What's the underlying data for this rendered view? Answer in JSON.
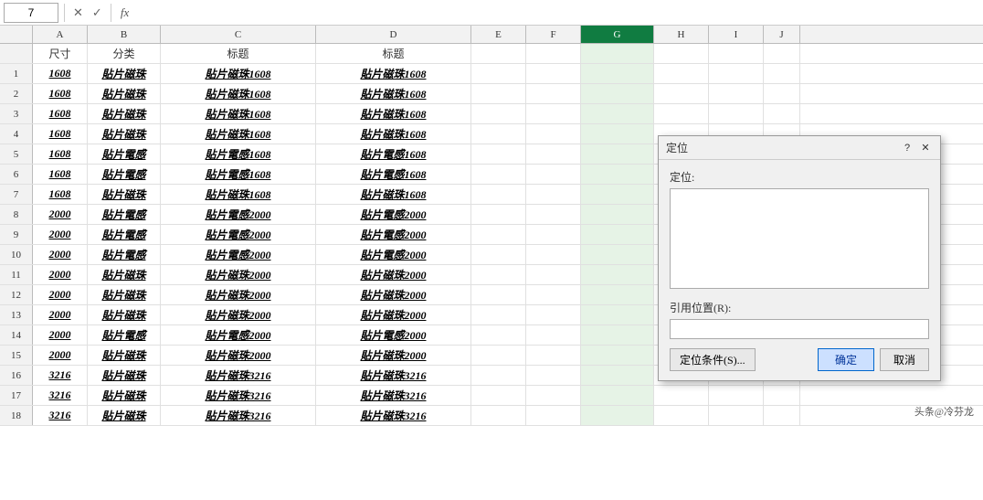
{
  "formulaBar": {
    "cellName": "7",
    "cancelLabel": "✕",
    "confirmLabel": "✓",
    "fxLabel": "fx",
    "formula": ""
  },
  "columns": {
    "headers": [
      "A",
      "B",
      "C",
      "D",
      "E",
      "F",
      "G",
      "H",
      "I",
      "J"
    ]
  },
  "headerRow": {
    "cells": [
      "尺寸",
      "分类",
      "标题",
      "标题",
      "",
      "",
      "",
      "",
      "",
      ""
    ]
  },
  "rows": [
    {
      "num": 1,
      "cells": [
        "1608",
        "貼片磁珠",
        "貼片磁珠1608",
        "貼片磁珠1608",
        "",
        "",
        "",
        "",
        "",
        ""
      ]
    },
    {
      "num": 2,
      "cells": [
        "1608",
        "貼片磁珠",
        "貼片磁珠1608",
        "貼片磁珠1608",
        "",
        "",
        "",
        "",
        "",
        ""
      ]
    },
    {
      "num": 3,
      "cells": [
        "1608",
        "貼片磁珠",
        "貼片磁珠1608",
        "貼片磁珠1608",
        "",
        "",
        "",
        "",
        "",
        ""
      ]
    },
    {
      "num": 4,
      "cells": [
        "1608",
        "貼片磁珠",
        "貼片磁珠1608",
        "貼片磁珠1608",
        "",
        "",
        "",
        "",
        "",
        ""
      ]
    },
    {
      "num": 5,
      "cells": [
        "1608",
        "貼片電感",
        "貼片電感1608",
        "貼片電感1608",
        "",
        "",
        "",
        "",
        "",
        ""
      ]
    },
    {
      "num": 6,
      "cells": [
        "1608",
        "貼片電感",
        "貼片電感1608",
        "貼片電感1608",
        "",
        "",
        "",
        "",
        "",
        ""
      ]
    },
    {
      "num": 7,
      "cells": [
        "1608",
        "貼片磁珠",
        "貼片磁珠1608",
        "貼片磁珠1608",
        "",
        "",
        "",
        "",
        "",
        ""
      ]
    },
    {
      "num": 8,
      "cells": [
        "2000",
        "貼片電感",
        "貼片電感2000",
        "貼片電感2000",
        "",
        "",
        "",
        "",
        "",
        ""
      ]
    },
    {
      "num": 9,
      "cells": [
        "2000",
        "貼片電感",
        "貼片電感2000",
        "貼片電感2000",
        "",
        "",
        "",
        "",
        "",
        ""
      ]
    },
    {
      "num": 10,
      "cells": [
        "2000",
        "貼片電感",
        "貼片電感2000",
        "貼片電感2000",
        "",
        "",
        "",
        "",
        "",
        ""
      ]
    },
    {
      "num": 11,
      "cells": [
        "2000",
        "貼片磁珠",
        "貼片磁珠2000",
        "貼片磁珠2000",
        "",
        "",
        "",
        "",
        "",
        ""
      ]
    },
    {
      "num": 12,
      "cells": [
        "2000",
        "貼片磁珠",
        "貼片磁珠2000",
        "貼片磁珠2000",
        "",
        "",
        "",
        "",
        "",
        ""
      ]
    },
    {
      "num": 13,
      "cells": [
        "2000",
        "貼片磁珠",
        "貼片磁珠2000",
        "貼片磁珠2000",
        "",
        "",
        "",
        "",
        "",
        ""
      ]
    },
    {
      "num": 14,
      "cells": [
        "2000",
        "貼片電感",
        "貼片電感2000",
        "貼片電感2000",
        "",
        "",
        "",
        "",
        "",
        ""
      ]
    },
    {
      "num": 15,
      "cells": [
        "2000",
        "貼片磁珠",
        "貼片磁珠2000",
        "貼片磁珠2000",
        "",
        "",
        "",
        "",
        "",
        ""
      ]
    },
    {
      "num": 16,
      "cells": [
        "3216",
        "貼片磁珠",
        "貼片磁珠3216",
        "貼片磁珠3216",
        "",
        "",
        "",
        "",
        "",
        ""
      ]
    },
    {
      "num": 17,
      "cells": [
        "3216",
        "貼片磁珠",
        "貼片磁珠3216",
        "貼片磁珠3216",
        "",
        "",
        "",
        "",
        "",
        ""
      ]
    },
    {
      "num": 18,
      "cells": [
        "3216",
        "貼片磁珠",
        "貼片磁珠3216",
        "貼片磁珠3216",
        "",
        "",
        "",
        "",
        "",
        ""
      ]
    }
  ],
  "dialog": {
    "title": "定位",
    "questionMark": "?",
    "closeLabel": "✕",
    "gotoLabel": "定位:",
    "refLabel": "引用位置(R):",
    "refPlaceholder": "",
    "specialBtnLabel": "定位条件(S)...",
    "confirmBtnLabel": "确定",
    "cancelBtnLabel": "取消"
  },
  "watermark": "头条@冷芬龙"
}
